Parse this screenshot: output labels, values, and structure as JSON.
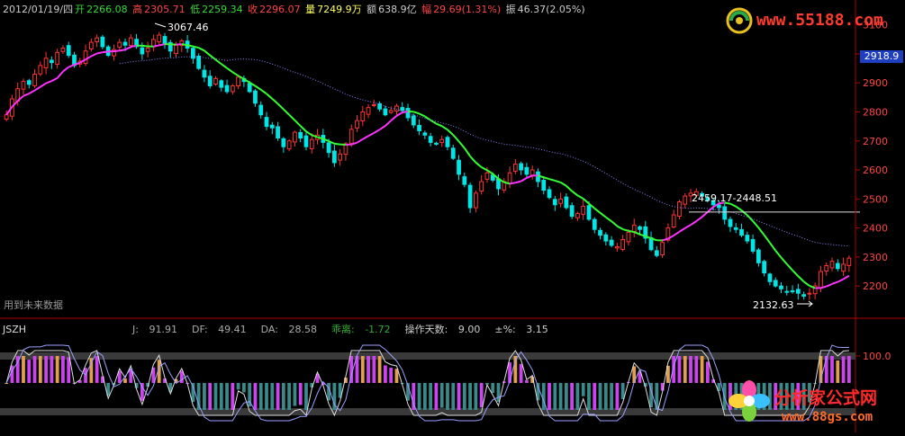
{
  "info_bar": {
    "date": "2012/01/19/四",
    "open_label": "开",
    "open": "2266.08",
    "high_label": "高",
    "high": "2305.71",
    "low_label": "低",
    "low": "2259.34",
    "close_label": "收",
    "close": "2296.07",
    "volume_label": "量",
    "volume": "7249.9万",
    "amount_label": "额",
    "amount": "638.9亿",
    "change_label": "幅",
    "change": "29.69(1.31%)",
    "amplitude_label": "振",
    "amplitude": "46.37(2.05%)"
  },
  "annotations": {
    "peak": "3067.46",
    "trough": "2132.63",
    "range": "2459.17-2448.51",
    "future_data_note": "用到未来数据"
  },
  "current_price_tag": "2918.9",
  "indicator": {
    "name": "JSZH",
    "j_label": "J:",
    "j": "91.91",
    "df_label": "DF:",
    "df": "49.41",
    "da_label": "DA:",
    "da": "28.58",
    "bias_label": "乖离:",
    "bias": "-1.72",
    "days_label": "操作天数:",
    "days": "9.00",
    "pct_label": "±%:",
    "pct": "3.15",
    "level_label": "100.0"
  },
  "watermarks": {
    "top_url": "www.55188.com",
    "bottom_name": "分析家公式网",
    "bottom_url": "www.88gs.com"
  },
  "colors": {
    "up": "#ff3333",
    "down": "#00e5e5",
    "ma_green": "#33ff33",
    "ma_magenta": "#ff33ff",
    "ma_dotted": "#8a8aff",
    "axis": "#b00000",
    "axis_text": "#ff4444",
    "ind_magenta": "#cc44ee",
    "ind_orange": "#e0a050",
    "ind_teal": "#3a8a8a"
  },
  "chart_data": [
    {
      "type": "candlestick",
      "title": "",
      "ylim": [
        2095,
        3130
      ],
      "yticks": [
        2200,
        2300,
        2400,
        2500,
        2600,
        2700,
        2800,
        2900,
        3000,
        3100
      ],
      "grid": false,
      "closes": [
        2790,
        2845,
        2880,
        2905,
        2895,
        2930,
        2960,
        2985,
        2970,
        3005,
        3020,
        2995,
        2960,
        2975,
        3010,
        3040,
        3055,
        3025,
        2995,
        3015,
        3040,
        3030,
        3055,
        3025,
        3000,
        3020,
        3050,
        3065,
        3035,
        3010,
        3030,
        3045,
        3020,
        2985,
        2950,
        2920,
        2890,
        2915,
        2885,
        2870,
        2890,
        2920,
        2905,
        2870,
        2830,
        2790,
        2750,
        2745,
        2710,
        2680,
        2700,
        2730,
        2710,
        2680,
        2705,
        2720,
        2695,
        2660,
        2625,
        2655,
        2690,
        2740,
        2770,
        2800,
        2815,
        2825,
        2810,
        2790,
        2805,
        2820,
        2805,
        2780,
        2755,
        2735,
        2720,
        2695,
        2690,
        2705,
        2680,
        2640,
        2585,
        2550,
        2470,
        2520,
        2560,
        2590,
        2565,
        2535,
        2560,
        2590,
        2620,
        2600,
        2585,
        2600,
        2560,
        2530,
        2505,
        2480,
        2500,
        2470,
        2440,
        2450,
        2475,
        2430,
        2395,
        2375,
        2355,
        2340,
        2335,
        2360,
        2385,
        2410,
        2395,
        2365,
        2325,
        2305,
        2350,
        2400,
        2445,
        2490,
        2510,
        2520,
        2525,
        2510,
        2495,
        2480,
        2470,
        2430,
        2405,
        2395,
        2375,
        2355,
        2320,
        2280,
        2245,
        2215,
        2200,
        2190,
        2180,
        2180,
        2175,
        2165,
        2175,
        2200,
        2250,
        2270,
        2285,
        2260,
        2275,
        2296
      ],
      "ma_short": {
        "name": "",
        "values_note": "computed in script"
      },
      "ma_long": {
        "name": ""
      }
    },
    {
      "type": "bar",
      "title": "",
      "ylim": [
        -100,
        120
      ],
      "level": 100
    }
  ]
}
